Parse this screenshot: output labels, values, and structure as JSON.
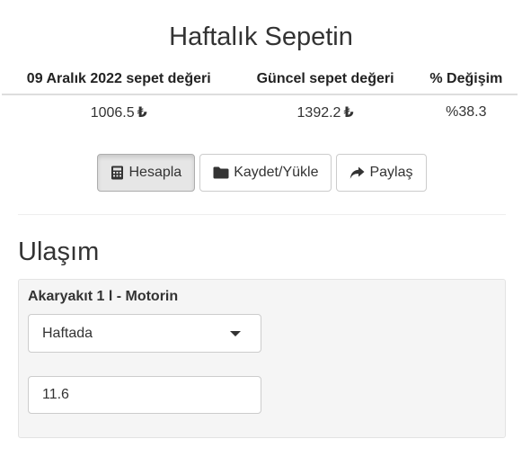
{
  "basket": {
    "title": "Haftalık Sepetin",
    "columns": [
      "09 Aralık 2022 sepet değeri",
      "Güncel sepet değeri",
      "% Değişim"
    ],
    "values": {
      "past_value": "1006.5",
      "current_value": "1392.2",
      "change": "%38.3",
      "currency_symbol": "₺"
    }
  },
  "actions": {
    "calculate_label": "Hesapla",
    "save_load_label": "Kaydet/Yükle",
    "share_label": "Paylaş"
  },
  "section": {
    "title": "Ulaşım",
    "item": {
      "label": "Akaryakıt 1 l - Motorin",
      "frequency_selected": "Haftada",
      "quantity_value": "11.6"
    }
  },
  "icons": {
    "calculate": "calculator-icon",
    "save_load": "folder-icon",
    "share": "share-icon",
    "dropdown": "caret-down-icon"
  }
}
